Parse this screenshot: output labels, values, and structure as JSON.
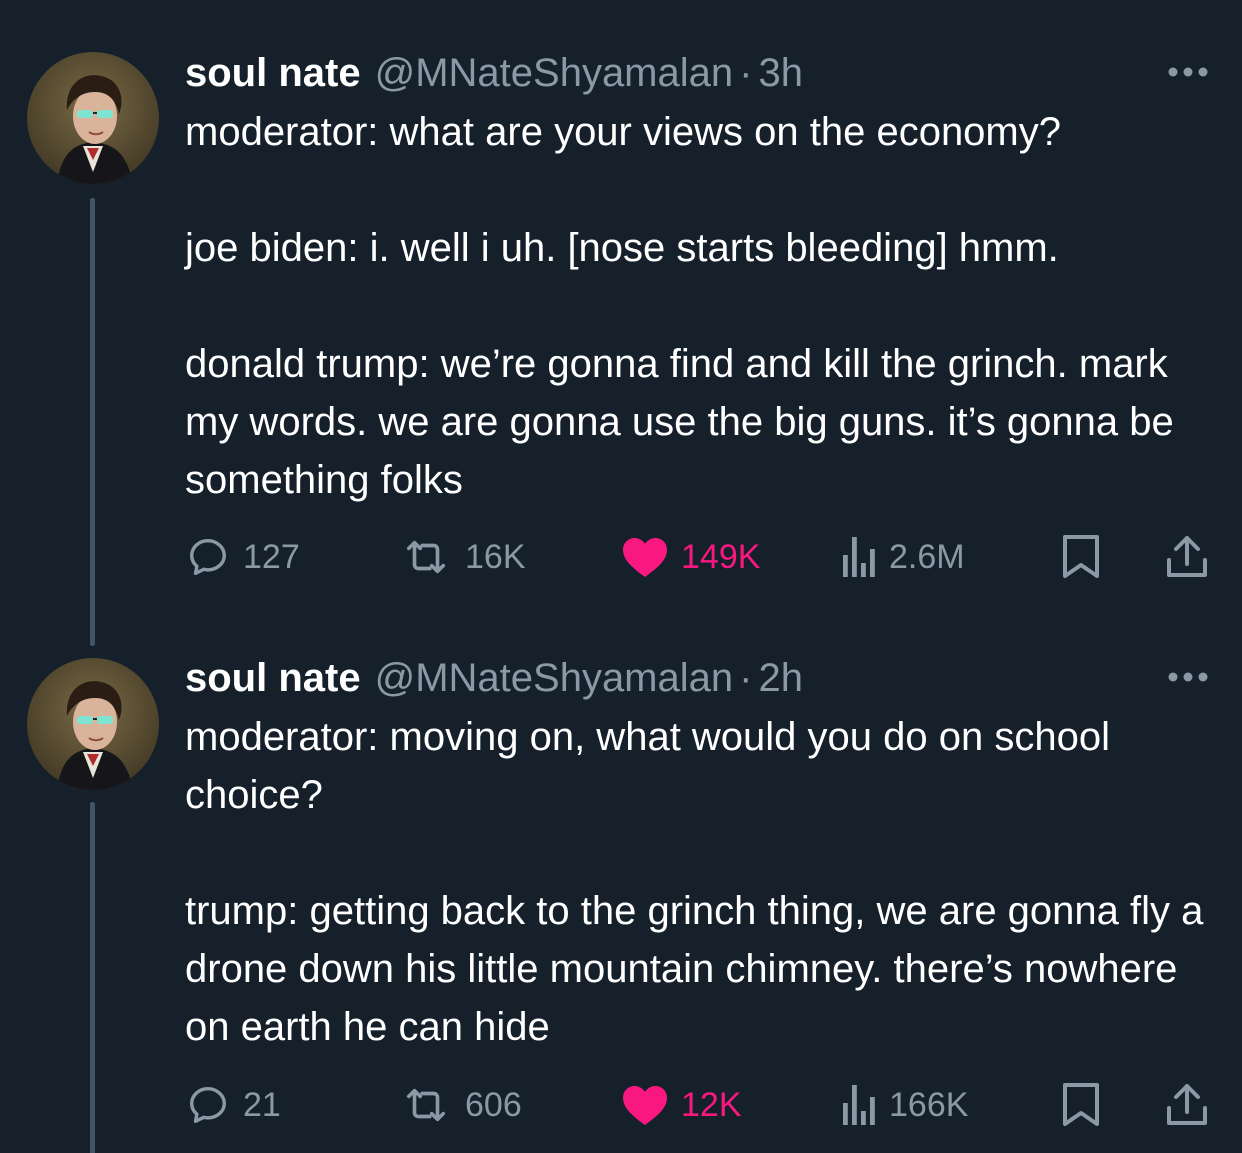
{
  "colors": {
    "background": "#15202b",
    "text_primary": "#ffffff",
    "text_secondary": "#8b98a5",
    "like_active": "#f91880",
    "thread_line": "#425364"
  },
  "tweets": [
    {
      "avatar_icon": "portrait-avatar-with-sunglasses",
      "display_name": "soul nate",
      "handle": "@MNateShyamalan",
      "separator": "·",
      "time": "3h",
      "text": "moderator: what are your views on the economy?\n\njoe biden: i. well i uh. [nose starts bleeding] hmm.\n\ndonald trump: we’re gonna find and kill the grinch. mark my words. we are gonna use the big guns. it’s gonna be something folks",
      "stats": {
        "replies": "127",
        "retweets": "16K",
        "likes": "149K",
        "views": "2.6M"
      },
      "liked": true
    },
    {
      "avatar_icon": "portrait-avatar-with-sunglasses",
      "display_name": "soul nate",
      "handle": "@MNateShyamalan",
      "separator": "·",
      "time": "2h",
      "text": "moderator: moving on, what would you do on school choice?\n\ntrump: getting back to the grinch thing, we are gonna fly a drone down his little mountain chimney. there’s nowhere on earth he can hide",
      "stats": {
        "replies": "21",
        "retweets": "606",
        "likes": "12K",
        "views": "166K"
      },
      "liked": true
    }
  ]
}
